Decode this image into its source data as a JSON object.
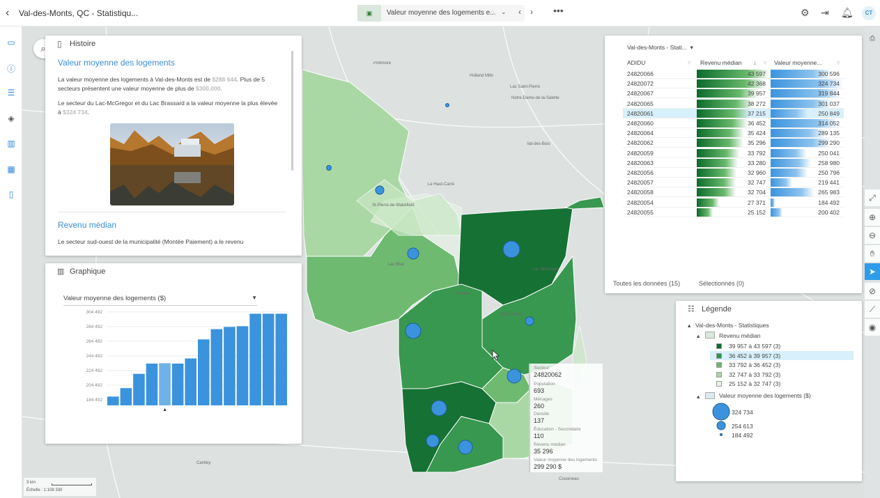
{
  "topbar": {
    "title": "Val-des-Monts, QC - Statistiqu...",
    "story_thumb": "▣",
    "story_label": "Valeur moyenne des logements e...",
    "avatar": "CT",
    "icons": [
      "back-icon",
      "gear-icon",
      "exit-icon",
      "bell-icon"
    ]
  },
  "search": {
    "icon": "⌕"
  },
  "histoire": {
    "title": "Histoire",
    "heading": "Valeur moyenne des logements",
    "p1_before": "La valeur moyenne des logements à Val-des-Monts est de ",
    "p1_v1": "$288 644",
    "p1_mid": ". Plus de 5 secteurs présentent une valeur moyenne de plus de ",
    "p1_v2": "$300,000",
    "p1_end": ".",
    "p2_before": "Le secteur du Lac-McGregor et du Lac Brassard a la valeur moyenne la plus élevée à ",
    "p2_v": "$324 734",
    "p2_end": ".",
    "heading2": "Revenu médian",
    "p3": "Le secteur sud-ouest de la municipalité (Montée Paiement) a le revenu"
  },
  "graphique": {
    "title": "Graphique",
    "select": "Valeur moyenne des logements ($)"
  },
  "chart_data": {
    "type": "bar",
    "title": "",
    "xlabel": "",
    "ylabel": "",
    "y_ticks": [
      "304 492",
      "284 492",
      "264 492",
      "244 492",
      "224 492",
      "204 492",
      "184 492"
    ],
    "ylim": [
      177000,
      310000
    ],
    "values": [
      189000,
      200500,
      220000,
      234000,
      234500,
      234000,
      241000,
      267000,
      281000,
      284000,
      285000,
      302000,
      302000,
      302000
    ],
    "selected_index": 4,
    "colors": {
      "bar": "#3b93dd",
      "selected": "#6fb2e7"
    }
  },
  "table": {
    "area_select": "Val-des-Monts - Stati...",
    "col_id": "ADIDU",
    "col_rev": "Revenu médian",
    "col_val": "Valeur moyenne...",
    "rows": [
      {
        "id": "24820066",
        "rev": "43 597",
        "val": "300 596",
        "revn": 43597,
        "valn": 300596
      },
      {
        "id": "24820072",
        "rev": "42 368",
        "val": "324 734",
        "revn": 42368,
        "valn": 324734
      },
      {
        "id": "24820067",
        "rev": "39 957",
        "val": "319 844",
        "revn": 39957,
        "valn": 319844
      },
      {
        "id": "24820065",
        "rev": "38 272",
        "val": "301 037",
        "revn": 38272,
        "valn": 301037
      },
      {
        "id": "24820061",
        "rev": "37 215",
        "val": "250 849",
        "revn": 37215,
        "valn": 250849
      },
      {
        "id": "24820060",
        "rev": "36 452",
        "val": "314 052",
        "revn": 36452,
        "valn": 314052
      },
      {
        "id": "24820064",
        "rev": "35 424",
        "val": "289 135",
        "revn": 35424,
        "valn": 289135
      },
      {
        "id": "24820062",
        "rev": "35 296",
        "val": "299 290",
        "revn": 35296,
        "valn": 299290
      },
      {
        "id": "24820059",
        "rev": "33 792",
        "val": "250 041",
        "revn": 33792,
        "valn": 250041
      },
      {
        "id": "24820063",
        "rev": "33 280",
        "val": "258 980",
        "revn": 33280,
        "valn": 258980
      },
      {
        "id": "24820056",
        "rev": "32 960",
        "val": "250 796",
        "revn": 32960,
        "valn": 250796
      },
      {
        "id": "24820057",
        "rev": "32 747",
        "val": "219 441",
        "revn": 32747,
        "valn": 219441
      },
      {
        "id": "24820058",
        "rev": "32 704",
        "val": "265 983",
        "revn": 32704,
        "valn": 265983
      },
      {
        "id": "24820054",
        "rev": "27 371",
        "val": "184 492",
        "revn": 27371,
        "valn": 184492
      },
      {
        "id": "24820055",
        "rev": "25 152",
        "val": "200 402",
        "revn": 25152,
        "valn": 200402
      }
    ],
    "selected_index": 4,
    "tab_all": "Toutes les données (15)",
    "tab_selected": "Sélectionnés (0)"
  },
  "legend": {
    "title": "Légende",
    "group": "Val-des-Monts - Statistiques",
    "layer1": "Revenu médian",
    "classes": [
      {
        "label": "39 957 à 43 597 (3)",
        "color": "#0b6b2c"
      },
      {
        "label": "36 452 à 39 957 (3)",
        "color": "#2f9447"
      },
      {
        "label": "33 792 à 36 452 (3)",
        "color": "#68b86b"
      },
      {
        "label": "32 747 à 33 792 (3)",
        "color": "#a7d7a2"
      },
      {
        "label": "25 152 à 32 747 (3)",
        "color": "#e8f5e4"
      }
    ],
    "layer2": "Valeur moyenne des logements ($)",
    "sizes": [
      "324 734",
      "254 613",
      "184 492"
    ]
  },
  "popup": {
    "k1": "Secteur",
    "v1": "24820062",
    "k2": "Population",
    "v2": "693",
    "k3": "Ménages",
    "v3": "260",
    "k4": "Densité",
    "v4": "137",
    "k5": "Éducation - Secondaire",
    "v5": "110",
    "k6": "Revenu médian",
    "v6": "35 296",
    "k7": "Valeur moyenne des logements",
    "v7": "299 290 $"
  },
  "map": {
    "places": [
      "Poltimore",
      "Holland Mills",
      "Lac Saint-Pierre",
      "Notre-Dame-de-la-Salette",
      "Val-des-Bois",
      "Le Haut-Carré",
      "St-Pierre-de-Wakefield",
      "Lac Blue",
      "Perkins",
      "Lac McGregor",
      "Saint-Pierre",
      "Cantley",
      "Cousineau"
    ],
    "scale_text": "3 km",
    "scale_ratio": "Échelle : 1:108 330"
  }
}
